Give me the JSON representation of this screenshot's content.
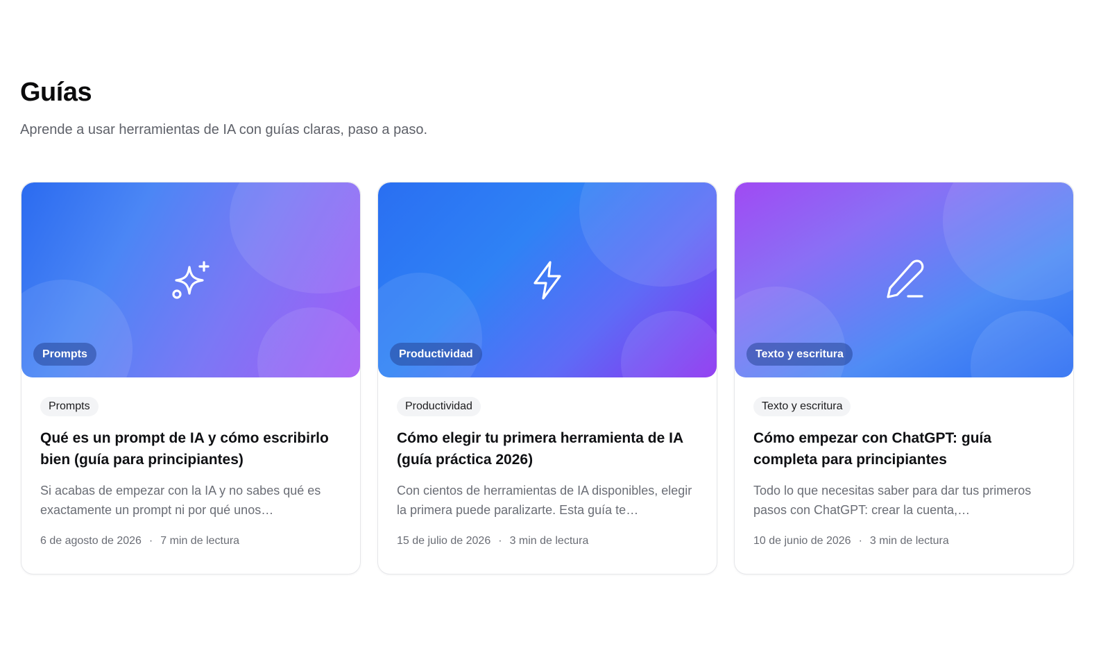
{
  "header": {
    "title": "Guías",
    "subtitle": "Aprende a usar herramientas de IA con guías claras, paso a paso."
  },
  "cards": [
    {
      "icon": "sparkles-icon",
      "cover_badge": "Prompts",
      "category": "Prompts",
      "title": "Qué es un prompt de IA y cómo escribirlo bien (guía para principiantes)",
      "excerpt": "Si acabas de empezar con la IA y no sabes qué es exactamente un prompt ni por qué unos…",
      "date": "6 de agosto de 2026",
      "separator": "·",
      "read_time": "7 min de lectura"
    },
    {
      "icon": "lightning-icon",
      "cover_badge": "Productividad",
      "category": "Productividad",
      "title": "Cómo elegir tu primera herramienta de IA (guía práctica 2026)",
      "excerpt": "Con cientos de herramientas de IA disponibles, elegir la primera puede paralizarte. Esta guía te…",
      "date": "15 de julio de 2026",
      "separator": "·",
      "read_time": "3 min de lectura"
    },
    {
      "icon": "pencil-icon",
      "cover_badge": "Texto y escritura",
      "category": "Texto y escritura",
      "title": "Cómo empezar con ChatGPT: guía completa para principiantes",
      "excerpt": "Todo lo que necesitas saber para dar tus primeros pasos con ChatGPT: crear la cuenta,…",
      "date": "10 de junio de 2026",
      "separator": "·",
      "read_time": "3 min de lectura"
    }
  ]
}
